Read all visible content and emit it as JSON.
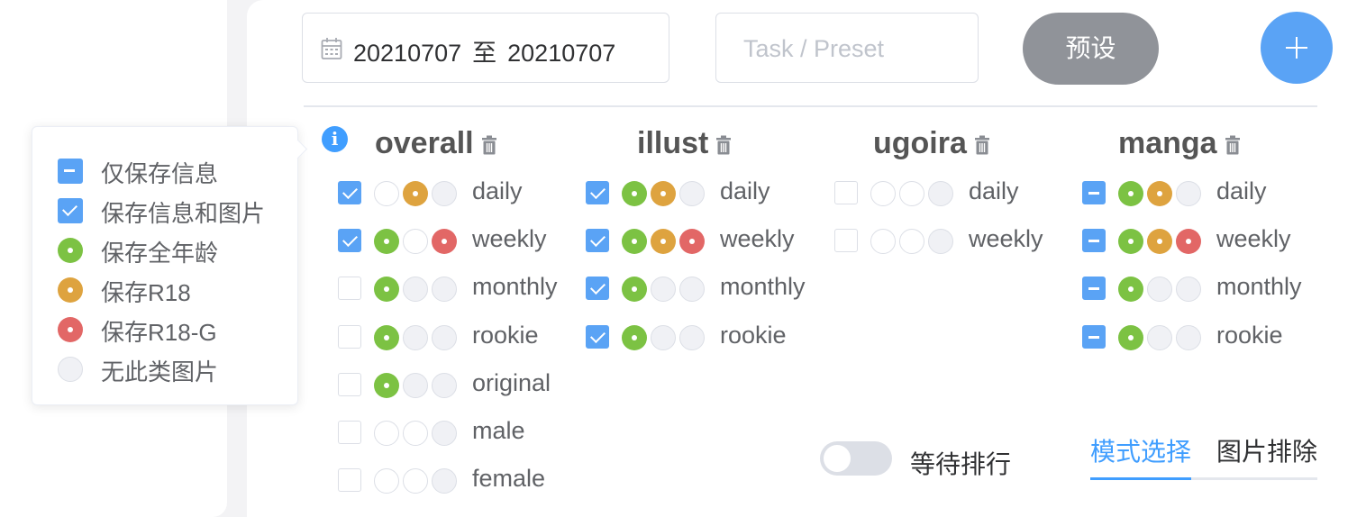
{
  "toolbar": {
    "date_start": "20210707",
    "date_sep": "至",
    "date_end": "20210707",
    "task_placeholder": "Task / Preset",
    "preset_label": "预设",
    "add_icon": "plus-icon"
  },
  "legend": [
    {
      "icon": "indeterminate-checkbox",
      "label": "仅保存信息"
    },
    {
      "icon": "checked-checkbox",
      "label": "保存信息和图片"
    },
    {
      "icon": "green-dot",
      "label": "保存全年龄"
    },
    {
      "icon": "orange-dot",
      "label": "保存R18"
    },
    {
      "icon": "red-dot",
      "label": "保存R18-G"
    },
    {
      "icon": "empty-dot",
      "label": "无此类图片"
    }
  ],
  "colors": {
    "accent": "#409eff",
    "green": "#7cc243",
    "orange": "#dea33f",
    "red": "#e26766"
  },
  "columns": [
    {
      "title": "overall",
      "rows": [
        {
          "label": "daily",
          "state": "checked",
          "dots": [
            "empty",
            "orange",
            "fill"
          ]
        },
        {
          "label": "weekly",
          "state": "checked",
          "dots": [
            "green",
            "empty",
            "red"
          ]
        },
        {
          "label": "monthly",
          "state": "unchecked",
          "dots": [
            "green",
            "fill",
            "fill"
          ]
        },
        {
          "label": "rookie",
          "state": "unchecked",
          "dots": [
            "green",
            "fill",
            "fill"
          ]
        },
        {
          "label": "original",
          "state": "unchecked",
          "dots": [
            "green",
            "fill",
            "fill"
          ]
        },
        {
          "label": "male",
          "state": "unchecked",
          "dots": [
            "empty",
            "empty",
            "fill"
          ]
        },
        {
          "label": "female",
          "state": "unchecked",
          "dots": [
            "empty",
            "empty",
            "fill"
          ]
        }
      ]
    },
    {
      "title": "illust",
      "rows": [
        {
          "label": "daily",
          "state": "checked",
          "dots": [
            "green",
            "orange",
            "fill"
          ]
        },
        {
          "label": "weekly",
          "state": "checked",
          "dots": [
            "green",
            "orange",
            "red"
          ]
        },
        {
          "label": "monthly",
          "state": "checked",
          "dots": [
            "green",
            "fill",
            "fill"
          ]
        },
        {
          "label": "rookie",
          "state": "checked",
          "dots": [
            "green",
            "fill",
            "fill"
          ]
        }
      ]
    },
    {
      "title": "ugoira",
      "rows": [
        {
          "label": "daily",
          "state": "unchecked",
          "dots": [
            "empty",
            "empty",
            "fill"
          ]
        },
        {
          "label": "weekly",
          "state": "unchecked",
          "dots": [
            "empty",
            "empty",
            "fill"
          ]
        }
      ]
    },
    {
      "title": "manga",
      "rows": [
        {
          "label": "daily",
          "state": "indeterminate",
          "dots": [
            "green",
            "orange",
            "fill"
          ]
        },
        {
          "label": "weekly",
          "state": "indeterminate",
          "dots": [
            "green",
            "orange",
            "red"
          ]
        },
        {
          "label": "monthly",
          "state": "indeterminate",
          "dots": [
            "green",
            "fill",
            "fill"
          ]
        },
        {
          "label": "rookie",
          "state": "indeterminate",
          "dots": [
            "green",
            "fill",
            "fill"
          ]
        }
      ]
    }
  ],
  "footer": {
    "wait_label": "等待排行",
    "wait_on": false,
    "tabs": [
      {
        "label": "模式选择",
        "active": true
      },
      {
        "label": "图片排除",
        "active": false
      }
    ]
  }
}
